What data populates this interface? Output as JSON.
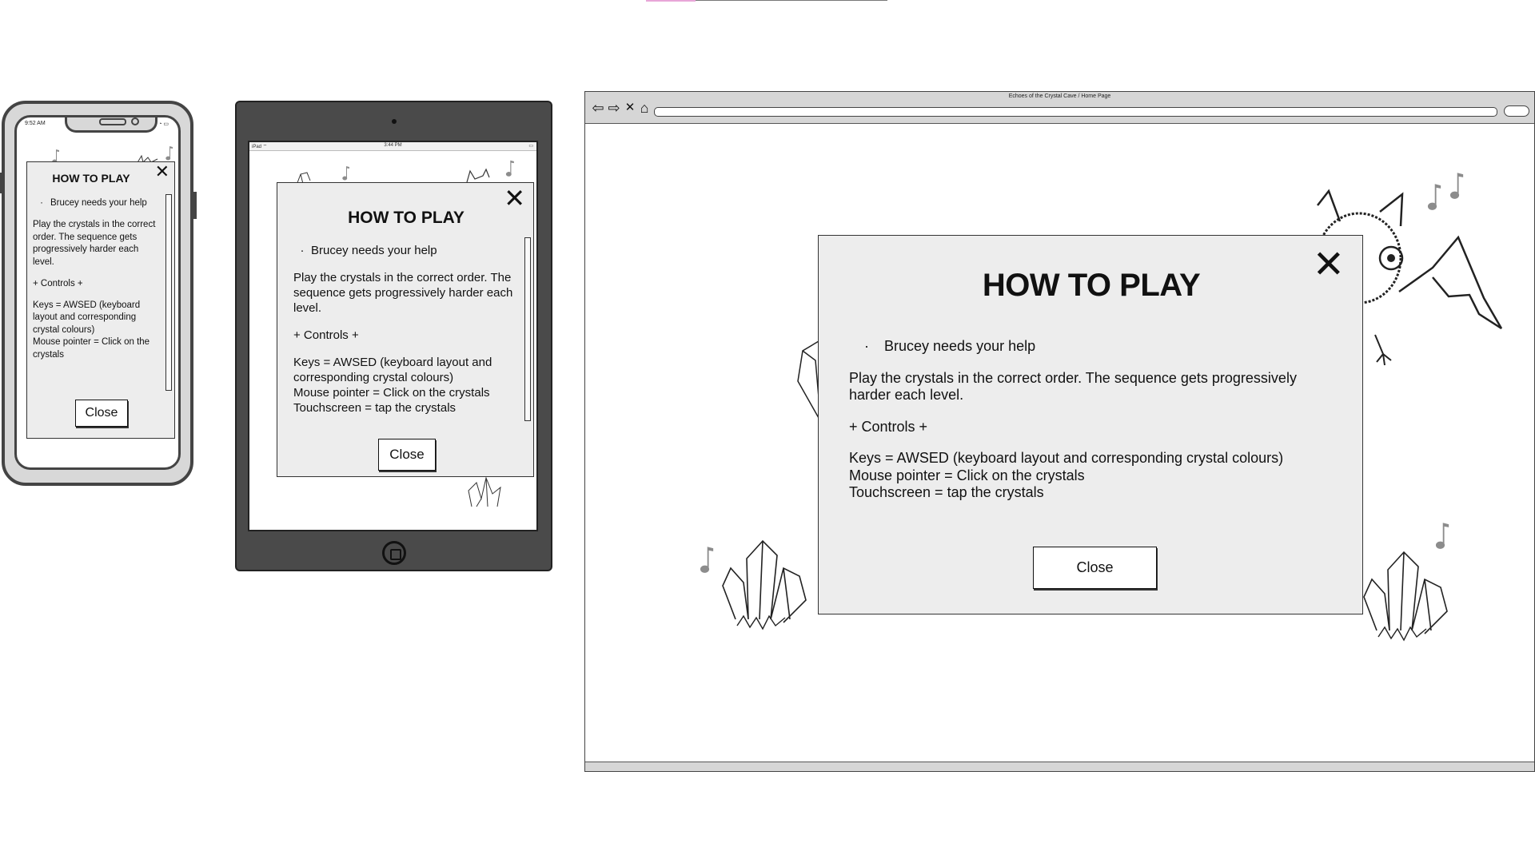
{
  "phone": {
    "status_time": "9:52 AM",
    "status_icons": "▪▪ ◔ ▭",
    "modal": {
      "title": "HOW TO PLAY",
      "close_icon": "✕",
      "bullet": "Brucey needs your help",
      "para1": "Play the crystals in the correct order. The sequence gets progressively harder each level.",
      "para2": "+ Controls +",
      "para3": "Keys = AWSED (keyboard layout and corresponding crystal colours)",
      "para4": "Mouse pointer = Click on the crystals",
      "close_label": "Close"
    }
  },
  "tablet": {
    "status_left": "iPad ⌔",
    "status_time": "3:44 PM",
    "status_right": "▭",
    "modal": {
      "title": "HOW TO PLAY",
      "close_icon": "✕",
      "bullet": "Brucey needs your help",
      "para1": "Play the crystals in the correct order. The sequence gets progressively harder each level.",
      "para2": "+ Controls +",
      "para3": "Keys = AWSED (keyboard layout and corresponding crystal colours)",
      "para4": "Mouse pointer = Click on the crystals",
      "para5": "Touchscreen = tap the crystals",
      "close_label": "Close"
    }
  },
  "browser": {
    "window_title": "Echoes of the Crystal Cave / Home Page",
    "nav": {
      "back_icon": "⇦",
      "forward_icon": "⇨",
      "stop_icon": "✕",
      "home_icon": "⌂"
    },
    "modal": {
      "title": "HOW TO PLAY",
      "close_icon": "✕",
      "bullet": "Brucey needs your help",
      "para1": "Play the crystals in the correct order. The sequence gets progressively harder each level.",
      "para2": "+ Controls +",
      "para3": "Keys = AWSED (keyboard layout and corresponding crystal colours)",
      "para4": "Mouse pointer = Click on the crystals",
      "para5": "Touchscreen = tap the crystals",
      "close_label": "Close"
    }
  },
  "bullet_glyph": "·",
  "colors": {
    "modal_bg": "#ededed",
    "frame": "#444444",
    "note": "#8c8c8c",
    "accent": "#e8a6d8"
  }
}
